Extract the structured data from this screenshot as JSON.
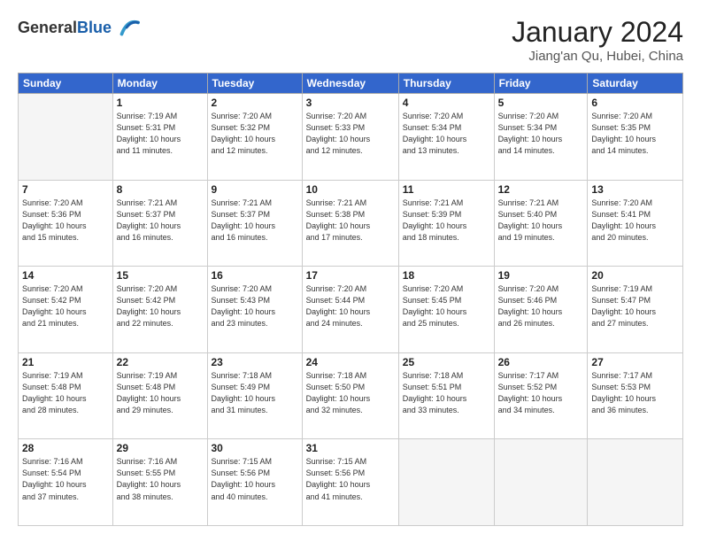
{
  "header": {
    "logo_line1": "General",
    "logo_line2": "Blue",
    "month": "January 2024",
    "location": "Jiang'an Qu, Hubei, China"
  },
  "weekdays": [
    "Sunday",
    "Monday",
    "Tuesday",
    "Wednesday",
    "Thursday",
    "Friday",
    "Saturday"
  ],
  "weeks": [
    [
      {
        "day": "",
        "info": ""
      },
      {
        "day": "1",
        "info": "Sunrise: 7:19 AM\nSunset: 5:31 PM\nDaylight: 10 hours\nand 11 minutes."
      },
      {
        "day": "2",
        "info": "Sunrise: 7:20 AM\nSunset: 5:32 PM\nDaylight: 10 hours\nand 12 minutes."
      },
      {
        "day": "3",
        "info": "Sunrise: 7:20 AM\nSunset: 5:33 PM\nDaylight: 10 hours\nand 12 minutes."
      },
      {
        "day": "4",
        "info": "Sunrise: 7:20 AM\nSunset: 5:34 PM\nDaylight: 10 hours\nand 13 minutes."
      },
      {
        "day": "5",
        "info": "Sunrise: 7:20 AM\nSunset: 5:34 PM\nDaylight: 10 hours\nand 14 minutes."
      },
      {
        "day": "6",
        "info": "Sunrise: 7:20 AM\nSunset: 5:35 PM\nDaylight: 10 hours\nand 14 minutes."
      }
    ],
    [
      {
        "day": "7",
        "info": "Sunrise: 7:20 AM\nSunset: 5:36 PM\nDaylight: 10 hours\nand 15 minutes."
      },
      {
        "day": "8",
        "info": "Sunrise: 7:21 AM\nSunset: 5:37 PM\nDaylight: 10 hours\nand 16 minutes."
      },
      {
        "day": "9",
        "info": "Sunrise: 7:21 AM\nSunset: 5:37 PM\nDaylight: 10 hours\nand 16 minutes."
      },
      {
        "day": "10",
        "info": "Sunrise: 7:21 AM\nSunset: 5:38 PM\nDaylight: 10 hours\nand 17 minutes."
      },
      {
        "day": "11",
        "info": "Sunrise: 7:21 AM\nSunset: 5:39 PM\nDaylight: 10 hours\nand 18 minutes."
      },
      {
        "day": "12",
        "info": "Sunrise: 7:21 AM\nSunset: 5:40 PM\nDaylight: 10 hours\nand 19 minutes."
      },
      {
        "day": "13",
        "info": "Sunrise: 7:20 AM\nSunset: 5:41 PM\nDaylight: 10 hours\nand 20 minutes."
      }
    ],
    [
      {
        "day": "14",
        "info": "Sunrise: 7:20 AM\nSunset: 5:42 PM\nDaylight: 10 hours\nand 21 minutes."
      },
      {
        "day": "15",
        "info": "Sunrise: 7:20 AM\nSunset: 5:42 PM\nDaylight: 10 hours\nand 22 minutes."
      },
      {
        "day": "16",
        "info": "Sunrise: 7:20 AM\nSunset: 5:43 PM\nDaylight: 10 hours\nand 23 minutes."
      },
      {
        "day": "17",
        "info": "Sunrise: 7:20 AM\nSunset: 5:44 PM\nDaylight: 10 hours\nand 24 minutes."
      },
      {
        "day": "18",
        "info": "Sunrise: 7:20 AM\nSunset: 5:45 PM\nDaylight: 10 hours\nand 25 minutes."
      },
      {
        "day": "19",
        "info": "Sunrise: 7:20 AM\nSunset: 5:46 PM\nDaylight: 10 hours\nand 26 minutes."
      },
      {
        "day": "20",
        "info": "Sunrise: 7:19 AM\nSunset: 5:47 PM\nDaylight: 10 hours\nand 27 minutes."
      }
    ],
    [
      {
        "day": "21",
        "info": "Sunrise: 7:19 AM\nSunset: 5:48 PM\nDaylight: 10 hours\nand 28 minutes."
      },
      {
        "day": "22",
        "info": "Sunrise: 7:19 AM\nSunset: 5:48 PM\nDaylight: 10 hours\nand 29 minutes."
      },
      {
        "day": "23",
        "info": "Sunrise: 7:18 AM\nSunset: 5:49 PM\nDaylight: 10 hours\nand 31 minutes."
      },
      {
        "day": "24",
        "info": "Sunrise: 7:18 AM\nSunset: 5:50 PM\nDaylight: 10 hours\nand 32 minutes."
      },
      {
        "day": "25",
        "info": "Sunrise: 7:18 AM\nSunset: 5:51 PM\nDaylight: 10 hours\nand 33 minutes."
      },
      {
        "day": "26",
        "info": "Sunrise: 7:17 AM\nSunset: 5:52 PM\nDaylight: 10 hours\nand 34 minutes."
      },
      {
        "day": "27",
        "info": "Sunrise: 7:17 AM\nSunset: 5:53 PM\nDaylight: 10 hours\nand 36 minutes."
      }
    ],
    [
      {
        "day": "28",
        "info": "Sunrise: 7:16 AM\nSunset: 5:54 PM\nDaylight: 10 hours\nand 37 minutes."
      },
      {
        "day": "29",
        "info": "Sunrise: 7:16 AM\nSunset: 5:55 PM\nDaylight: 10 hours\nand 38 minutes."
      },
      {
        "day": "30",
        "info": "Sunrise: 7:15 AM\nSunset: 5:56 PM\nDaylight: 10 hours\nand 40 minutes."
      },
      {
        "day": "31",
        "info": "Sunrise: 7:15 AM\nSunset: 5:56 PM\nDaylight: 10 hours\nand 41 minutes."
      },
      {
        "day": "",
        "info": ""
      },
      {
        "day": "",
        "info": ""
      },
      {
        "day": "",
        "info": ""
      }
    ]
  ]
}
